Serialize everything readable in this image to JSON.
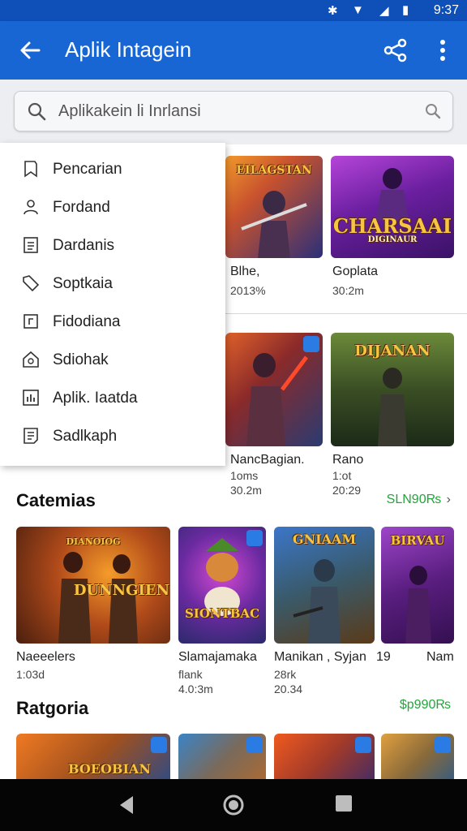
{
  "status": {
    "time": "9:37"
  },
  "app_bar": {
    "title": "Aplik Intagein"
  },
  "search": {
    "placeholder": "Aplikakein li Inrlansi"
  },
  "menu": [
    {
      "label": "Pencarian",
      "icon": "bookmark-icon"
    },
    {
      "label": "Fordand",
      "icon": "person-icon"
    },
    {
      "label": "Dardanis",
      "icon": "document-icon"
    },
    {
      "label": "Soptkaia",
      "icon": "tag-icon"
    },
    {
      "label": "Fidodiana",
      "icon": "square-icon"
    },
    {
      "label": "Sdiohak",
      "icon": "home-icon"
    },
    {
      "label": "Aplik. Iaatda",
      "icon": "chart-icon"
    },
    {
      "label": "Sadlkaph",
      "icon": "list-icon"
    }
  ],
  "top_cards": [
    {
      "art": "EILAGSTAN",
      "title": "Blhe,",
      "sub": "2013%",
      "colors": [
        "#f39a2b",
        "#2a2f7a"
      ]
    },
    {
      "art": "CHARSAAI",
      "art_sub": "DIGINAUR",
      "title": "Goplata",
      "sub": "30:2m",
      "colors": [
        "#b545d8",
        "#3a1266"
      ]
    },
    {
      "art": "",
      "title": "NancBagian.",
      "sub": "1oms",
      "sub2": "30.2m",
      "colors": [
        "#e0612a",
        "#2a3b72"
      ]
    },
    {
      "art": "DIJANAN",
      "title": "Rano",
      "sub": "1:ot",
      "sub2": "20:29",
      "colors": [
        "#6b8a3a",
        "#1c2a18"
      ]
    }
  ],
  "section1": {
    "title": "Catemias",
    "see_all": "SLN90₨",
    "cards": [
      {
        "art": "DUNNGIEN",
        "art_top": "DIANOIOG",
        "title": "Naeeelers",
        "sub": "1:03d",
        "colors": [
          "#f59c2a",
          "#4a1f0e"
        ]
      },
      {
        "art": "SIONTBAC",
        "title": "Slamajamaka",
        "sub": "flank",
        "sub2": "4.0:3m",
        "colors": [
          "#d34ad2",
          "#2a2a6a"
        ]
      },
      {
        "art": "GNIAAM",
        "title": "Manikan , Syjan",
        "sub": "28rk",
        "sub2": "20.34",
        "colors": [
          "#3b76c9",
          "#5a3a18"
        ]
      },
      {
        "art": "BIRVAU",
        "title": "19",
        "title2": "Nam",
        "colors": [
          "#9d45c9",
          "#341050"
        ]
      }
    ]
  },
  "section2": {
    "title": "Ratgoria",
    "see_all": "$р990₨",
    "cards": [
      {
        "art": "BOEOBIAN",
        "colors": [
          "#f07a22",
          "#274a8c"
        ]
      },
      {
        "art": "",
        "colors": [
          "#3a84c6",
          "#b36a2e"
        ]
      },
      {
        "art": "",
        "colors": [
          "#f05a1e",
          "#3a2a6a"
        ]
      },
      {
        "art": "",
        "colors": [
          "#e0a040",
          "#2a5a8a"
        ]
      }
    ]
  }
}
